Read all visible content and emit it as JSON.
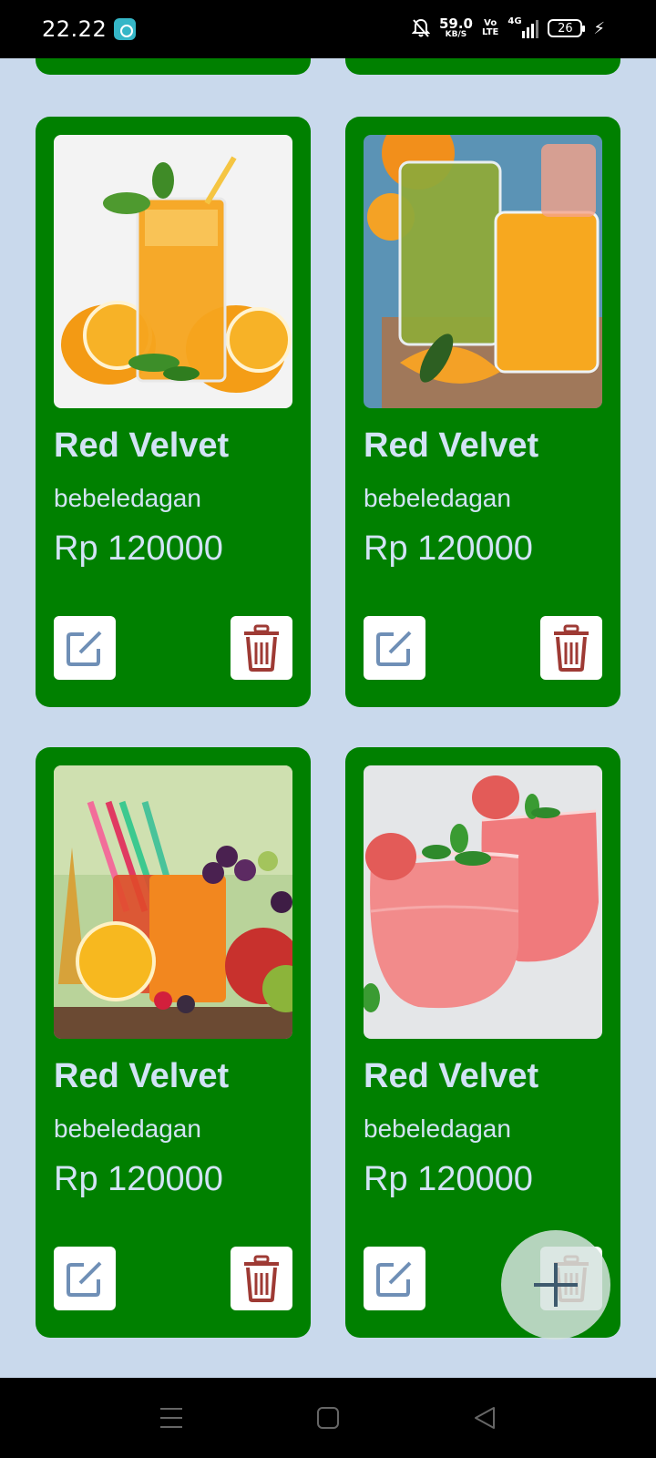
{
  "status_bar": {
    "time": "22.22",
    "net_speed_value": "59.0",
    "net_speed_unit": "KB/S",
    "volte_top": "Vo",
    "volte_bottom": "LTE",
    "network": "4G",
    "battery": "26"
  },
  "products": [
    {
      "name": "Red Velvet",
      "shop": "bebeledagan",
      "price": "Rp 120000",
      "image": "orange-juice-glass-photo"
    },
    {
      "name": "Red Velvet",
      "shop": "bebeledagan",
      "price": "Rp 120000",
      "image": "green-and-orange-juice-photo"
    },
    {
      "name": "Red Velvet",
      "shop": "bebeledagan",
      "price": "Rp 120000",
      "image": "fruit-juice-assortment-photo"
    },
    {
      "name": "Red Velvet",
      "shop": "bebeledagan",
      "price": "Rp 120000",
      "image": "watermelon-smoothie-photo"
    }
  ],
  "colors": {
    "background": "#c9d9ec",
    "card": "#008000",
    "card_text": "#d2e3f5",
    "delete_icon": "#9e3a34",
    "edit_icon": "#6f8fb6"
  }
}
